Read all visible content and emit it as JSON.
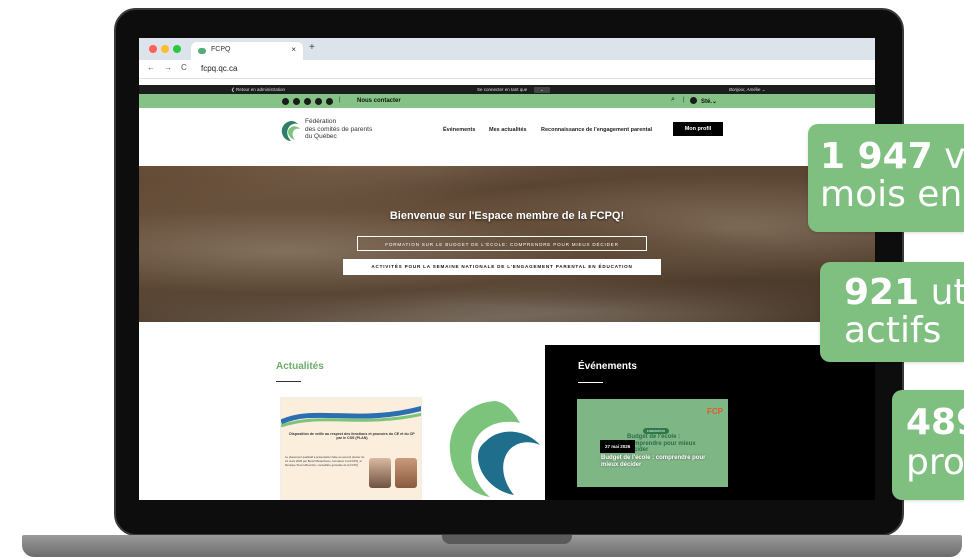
{
  "browser": {
    "tab_title": "FCPQ",
    "tab_close": "×",
    "new_tab": "+",
    "back": "←",
    "forward": "→",
    "reload": "C",
    "url": "fcpq.qc.ca"
  },
  "adminbar": {
    "back_admin": "❮ Retour en administration",
    "connect_as": "Se connecter en tant que",
    "dropdown": "⌄",
    "greeting": "Bonjour, Amélie ⌄"
  },
  "topbar": {
    "contact": "Nous contacter",
    "separator": "|",
    "site_label": "Sté.⌄",
    "search_icon": "⌕"
  },
  "header": {
    "org_name": "Fédération\ndes comités de parents\ndu Québec",
    "menu": [
      "Événements",
      "Mes actualités",
      "Reconnaissance de l'engagement parental"
    ],
    "profile_button": "Mon profil"
  },
  "hero": {
    "title": "Bienvenue sur l'Espace membre de la FCPQ!",
    "button1": "FORMATION SUR LE BUDGET DE L'ÉCOLE: COMPRENDRE POUR MIEUX DÉCIDER",
    "button2": "ACTIVITÉS POUR LA SEMAINE NATIONALE DE L'ENGAGEMENT PARENTAL EN ÉDUCATION"
  },
  "news": {
    "title": "Actualités",
    "card1_heading": "Disposition de veille au respect des fonctions et pouvoirs du CE et du CP par le CSS (PLAN)",
    "card1_body": "Le placement qualitatif a présentation faite au second plenier du 21 mars 2026 par Benoît Beauchene, formateur à la FCPQ, et Monique Simon-Bourdon, conseillère générale de la FCPQ."
  },
  "events": {
    "title": "Événements",
    "card_badge": "FORMATION",
    "card_heading": "Budget de l'école : comprendre pour mieux décider",
    "card_logo": "FCP",
    "date": "27 mai 2026",
    "card_title": "Budget de l'école : comprendre pour mieux décider"
  },
  "stats": [
    {
      "number": "1 947",
      "line1_rest": " v",
      "line2": "mois en"
    },
    {
      "number": "921",
      "line1_rest": " ut",
      "line2": "actifs"
    },
    {
      "number": "489",
      "line1_rest": "",
      "line2": "pro"
    }
  ],
  "colors": {
    "green_bar": "#85c285",
    "news_title": "#6aae6a",
    "stat_bg": "#7fc080",
    "events_bg": "#000000"
  },
  "icons": [
    "laptop-frame",
    "fcpq-logo-icon",
    "search-icon",
    "user-icon",
    "social-icons"
  ]
}
